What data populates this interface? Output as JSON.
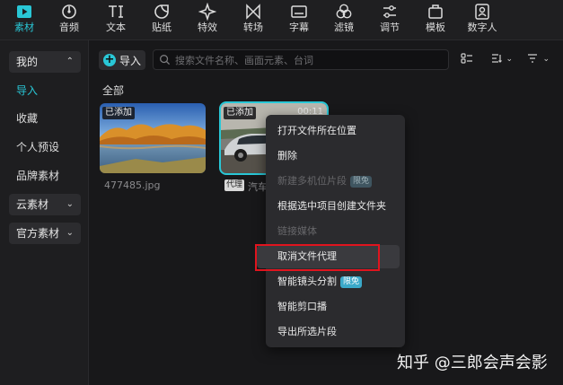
{
  "toolbar": {
    "items": [
      {
        "label": "素材",
        "icon": "play-square-icon",
        "active": true
      },
      {
        "label": "音频",
        "icon": "audio-disc-icon"
      },
      {
        "label": "文本",
        "icon": "text-tI-icon"
      },
      {
        "label": "贴纸",
        "icon": "sticker-icon"
      },
      {
        "label": "特效",
        "icon": "sparkle-star-icon"
      },
      {
        "label": "转场",
        "icon": "transition-bowtie-icon"
      },
      {
        "label": "字幕",
        "icon": "subtitle-box-icon"
      },
      {
        "label": "滤镜",
        "icon": "filter-circles-icon"
      },
      {
        "label": "调节",
        "icon": "adjust-sliders-icon"
      },
      {
        "label": "模板",
        "icon": "template-box-icon"
      },
      {
        "label": "数字人",
        "icon": "digital-human-icon"
      }
    ],
    "accent": "#29c7d6"
  },
  "sidebar": {
    "mine": "我的",
    "items": [
      "导入",
      "收藏",
      "个人预设",
      "品牌素材"
    ],
    "cloud": "云素材",
    "official": "官方素材"
  },
  "main": {
    "import_label": "导入",
    "search_placeholder": "搜索文件名称、画面元素、台词",
    "section_title": "全部",
    "cards": [
      {
        "tag": "已添加",
        "caption": "477485.jpg"
      },
      {
        "tag": "已添加",
        "duration": "00:11",
        "proxy_tag": "代理",
        "caption": "汽车"
      }
    ]
  },
  "context_menu": {
    "items": [
      {
        "label": "打开文件所在位置",
        "enabled": true
      },
      {
        "label": "删除",
        "enabled": true
      },
      {
        "label": "新建多机位片段",
        "enabled": false,
        "badge": "限免"
      },
      {
        "label": "根据选中项目创建文件夹",
        "enabled": true
      },
      {
        "label": "链接媒体",
        "enabled": false
      },
      {
        "label": "取消文件代理",
        "enabled": true,
        "highlighted": true
      },
      {
        "label": "智能镜头分割",
        "enabled": true,
        "badge": "限免"
      },
      {
        "label": "智能剪口播",
        "enabled": true
      },
      {
        "label": "导出所选片段",
        "enabled": true
      }
    ],
    "highlight_color": "#e0141e"
  },
  "watermark": "知乎 @三郎会声会影"
}
